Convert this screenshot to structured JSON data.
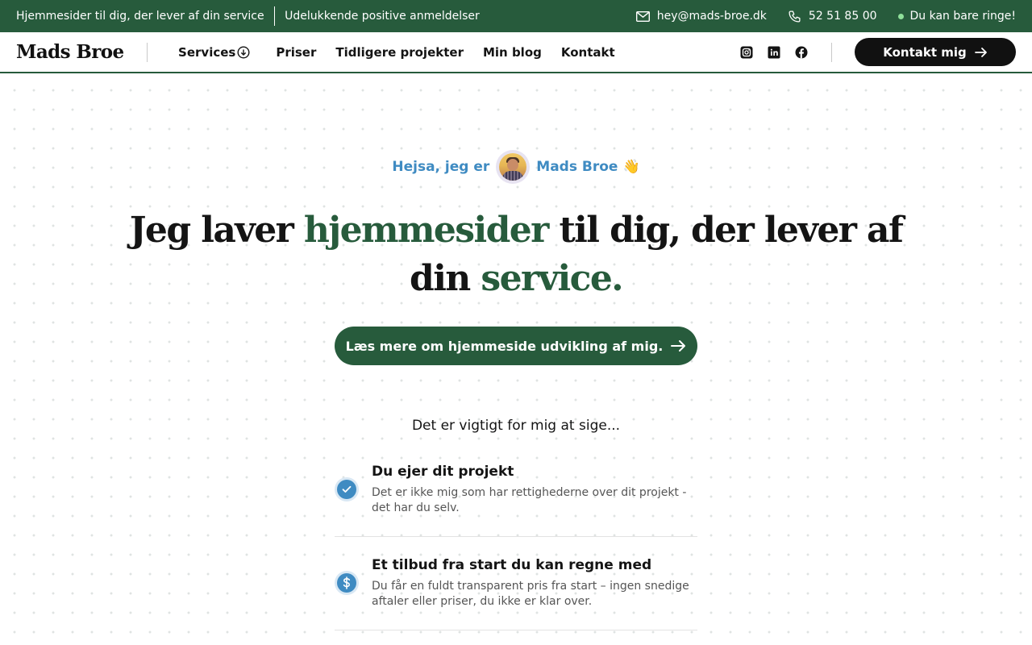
{
  "topbar": {
    "tagline": "Hjemmesider til dig, der lever af din service",
    "reviews": "Udelukkende positive anmeldelser",
    "email": "hey@mads-broe.dk",
    "phone": "52 51 85 00",
    "status": "Du kan bare ringe!",
    "status_color": "#8fe09a",
    "icons": [
      "mail-icon",
      "phone-icon"
    ]
  },
  "header": {
    "logo": "Mads Broe",
    "nav": [
      {
        "label": "Services",
        "icon": "chevron-down-circle-icon"
      },
      {
        "label": "Priser"
      },
      {
        "label": "Tidligere projekter"
      },
      {
        "label": "Min blog"
      },
      {
        "label": "Kontakt"
      }
    ],
    "socials": [
      "instagram-icon",
      "linkedin-icon",
      "facebook-icon"
    ],
    "cta_label": "Kontakt mig"
  },
  "hero": {
    "greeting_before": "Hejsa, jeg er",
    "greeting_name": "Mads Broe",
    "greeting_emoji": "👋",
    "headline_part1": "Jeg laver ",
    "headline_highlight1": "hjemmesider",
    "headline_part2": " til dig, der lever af din ",
    "headline_highlight2": "service.",
    "button_label": "Læs mere om hjemmeside udvikling af mig."
  },
  "important": {
    "intro": "Det er vigtigt for mig at sige...",
    "items": [
      {
        "icon": "check-icon",
        "title": "Du ejer dit projekt",
        "desc": "Det er ikke mig som har rettighederne over dit projekt - det har du selv."
      },
      {
        "icon": "dollar-icon",
        "title": "Et tilbud fra start du kan regne med",
        "desc": "Du får en fuldt transparent pris fra start – ingen snedige aftaler eller priser, du ikke er klar over."
      }
    ]
  },
  "colors": {
    "brand_green": "#275b3c",
    "accent_blue": "#3f8bc2",
    "dark": "#111111"
  }
}
